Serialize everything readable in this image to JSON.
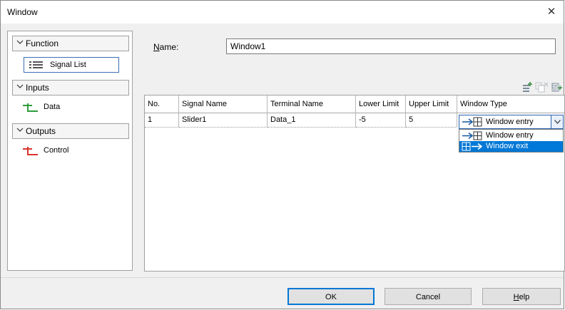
{
  "window": {
    "title": "Window",
    "close_glyph": "✕"
  },
  "sidebar": {
    "sections": [
      {
        "label": "Function",
        "chevron": "⌄",
        "items": [
          {
            "label": "Signal List",
            "icon": "list-icon"
          }
        ]
      },
      {
        "label": "Inputs",
        "chevron": "⌄",
        "items": [
          {
            "label": "Data",
            "icon": "input-connector-icon"
          }
        ]
      },
      {
        "label": "Outputs",
        "chevron": "⌄",
        "items": [
          {
            "label": "Control",
            "icon": "output-connector-icon"
          }
        ]
      }
    ]
  },
  "name_field": {
    "label_mnemonic": "N",
    "label_rest": "ame:",
    "value": "Window1"
  },
  "toolbar": {
    "icons": [
      "add-row-icon",
      "delete-row-icon",
      "insert-row-icon",
      "copy-row-icon",
      "clear-icon"
    ]
  },
  "table": {
    "columns": [
      "No.",
      "Signal Name",
      "Terminal Name",
      "Lower Limit",
      "Upper Limit",
      "Window Type"
    ],
    "rows": [
      {
        "no": "1",
        "signal_name": "Slider1",
        "terminal_name": "Data_1",
        "lower_limit": "-5",
        "upper_limit": "5",
        "window_type": "Window entry"
      }
    ]
  },
  "window_type_dropdown": {
    "selected": "Window entry",
    "options": [
      "Window entry",
      "Window exit"
    ],
    "highlighted": "Window exit"
  },
  "buttons": {
    "ok": "OK",
    "cancel": "Cancel",
    "help_mnemonic": "H",
    "help_rest": "elp"
  },
  "colors": {
    "accent": "#0078d7",
    "input_icon": "#2e9c3a",
    "output_icon": "#d9352a",
    "entry_icon": "#1f5fa8"
  }
}
